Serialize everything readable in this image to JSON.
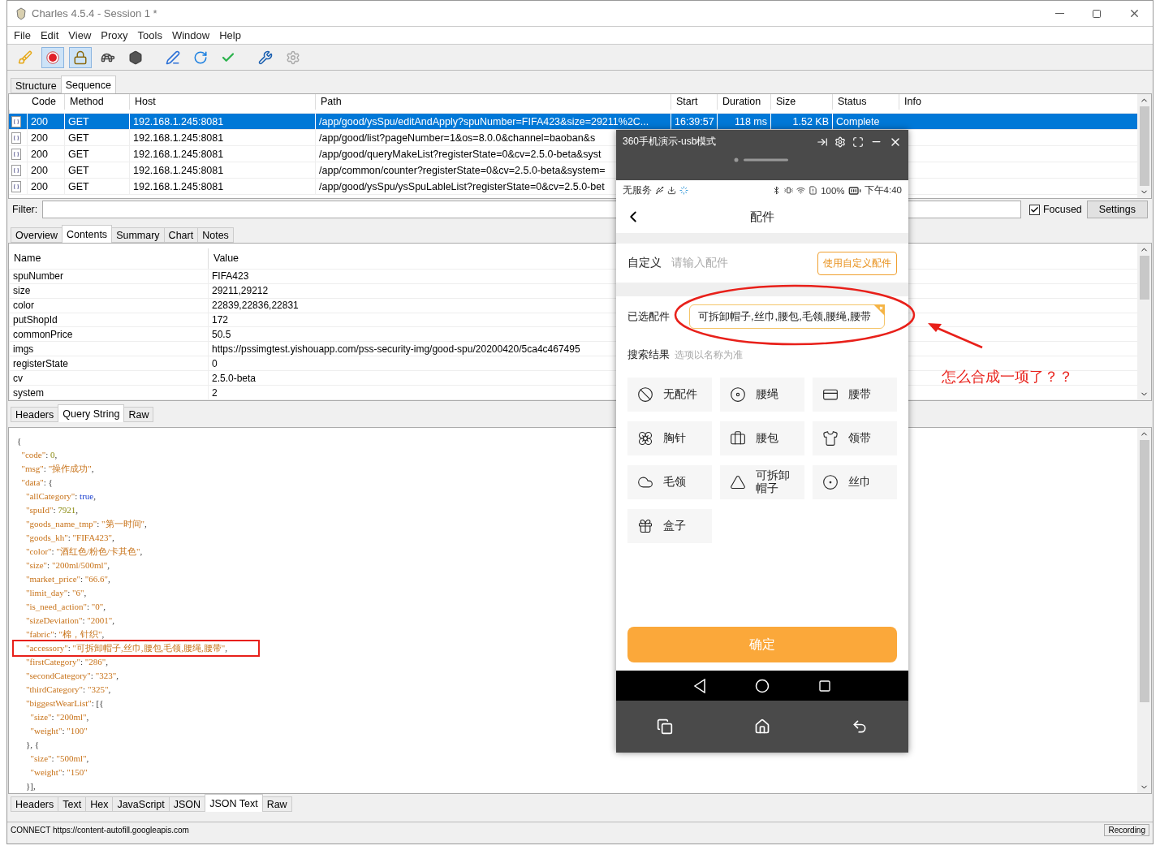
{
  "window": {
    "title": "Charles 4.5.4 - Session 1 *"
  },
  "menu": [
    "File",
    "Edit",
    "View",
    "Proxy",
    "Tools",
    "Window",
    "Help"
  ],
  "toolbar": [
    {
      "pressed": false
    },
    {
      "pressed": true
    },
    {
      "pressed": true
    },
    {
      "pressed": false
    },
    {
      "pressed": false
    },
    {
      "pressed": false
    },
    {
      "pressed": false
    },
    {
      "pressed": false
    },
    {
      "pressed": false
    },
    {
      "pressed": false
    }
  ],
  "view_tabs": [
    {
      "label": "Structure",
      "selected": false
    },
    {
      "label": "Sequence",
      "selected": true
    }
  ],
  "table": {
    "columns": [
      "Code",
      "Method",
      "Host",
      "Path",
      "Start",
      "Duration",
      "Size",
      "Status",
      "Info"
    ],
    "rows": [
      {
        "selected": true,
        "cells": [
          "200",
          "GET",
          "192.168.1.245:8081",
          "/app/good/ysSpu/editAndApply?spuNumber=FIFA423&size=29211%2C...",
          "16:39:57",
          "118 ms",
          "1.52 KB",
          "Complete",
          ""
        ]
      },
      {
        "selected": false,
        "cells": [
          "200",
          "GET",
          "192.168.1.245:8081",
          "/app/good/list?pageNumber=1&os=8.0.0&channel=baoban&s"
        ]
      },
      {
        "selected": false,
        "cells": [
          "200",
          "GET",
          "192.168.1.245:8081",
          "/app/good/queryMakeList?registerState=0&cv=2.5.0-beta&syst"
        ]
      },
      {
        "selected": false,
        "cells": [
          "200",
          "GET",
          "192.168.1.245:8081",
          "/app/common/counter?registerState=0&cv=2.5.0-beta&system="
        ]
      },
      {
        "selected": false,
        "cells": [
          "200",
          "GET",
          "192.168.1.245:8081",
          "/app/good/ysSpu/ysSpuLableList?registerState=0&cv=2.5.0-bet"
        ]
      }
    ]
  },
  "filter": {
    "label": "Filter:",
    "focused": {
      "label": "Focused",
      "checked": true
    },
    "settings": "Settings"
  },
  "detail_tabs": [
    {
      "label": "Overview",
      "selected": false
    },
    {
      "label": "Contents",
      "selected": true
    },
    {
      "label": "Summary",
      "selected": false
    },
    {
      "label": "Chart",
      "selected": false
    },
    {
      "label": "Notes",
      "selected": false
    }
  ],
  "params": {
    "columns": [
      "Name",
      "Value"
    ],
    "rows": [
      [
        "spuNumber",
        "FIFA423"
      ],
      [
        "size",
        "29211,29212"
      ],
      [
        "color",
        "22839,22836,22831"
      ],
      [
        "putShopId",
        "172"
      ],
      [
        "commonPrice",
        "50.5"
      ],
      [
        "imgs",
        "https://pssimgtest.yishouapp.com/pss-security-img/good-spu/20200420/5ca4c467495"
      ],
      [
        "registerState",
        "0"
      ],
      [
        "cv",
        "2.5.0-beta"
      ],
      [
        "system",
        "2"
      ]
    ]
  },
  "request_tabs": [
    {
      "label": "Headers",
      "selected": false
    },
    {
      "label": "Query String",
      "selected": true
    },
    {
      "label": "Raw",
      "selected": false
    }
  ],
  "code_lines": [
    {
      "text": "{",
      "highlighted": false
    },
    {
      "text": "  \"code\": 0,",
      "highlighted": false
    },
    {
      "text": "  \"msg\": \"操作成功\",",
      "highlighted": false
    },
    {
      "text": "  \"data\": {",
      "highlighted": false
    },
    {
      "text": "    \"allCategory\": true,",
      "highlighted": false
    },
    {
      "text": "    \"spuId\": 7921,",
      "highlighted": false
    },
    {
      "text": "    \"goods_name_tmp\": \"第一时间\",",
      "highlighted": false
    },
    {
      "text": "    \"goods_kh\": \"FIFA423\",",
      "highlighted": false
    },
    {
      "text": "    \"color\": \"酒红色/粉色/卡其色\",",
      "highlighted": false
    },
    {
      "text": "    \"size\": \"200ml/500ml\",",
      "highlighted": false
    },
    {
      "text": "    \"market_price\": \"66.6\",",
      "highlighted": false
    },
    {
      "text": "    \"limit_day\": \"6\",",
      "highlighted": false
    },
    {
      "text": "    \"is_need_action\": \"0\",",
      "highlighted": false
    },
    {
      "text": "    \"sizeDeviation\": \"2001\",",
      "highlighted": false
    },
    {
      "text": "    \"fabric\": \"棉，针织\",",
      "highlighted": false
    },
    {
      "text": "    \"accessory\": \"可拆卸帽子,丝巾,腰包,毛领,腰绳,腰带\",",
      "highlighted": true
    },
    {
      "text": "    \"firstCategory\": \"286\",",
      "highlighted": false
    },
    {
      "text": "    \"secondCategory\": \"323\",",
      "highlighted": false
    },
    {
      "text": "    \"thirdCategory\": \"325\",",
      "highlighted": false
    },
    {
      "text": "    \"biggestWearList\": [{",
      "highlighted": false
    },
    {
      "text": "      \"size\": \"200ml\",",
      "highlighted": false
    },
    {
      "text": "      \"weight\": \"100\"",
      "highlighted": false
    },
    {
      "text": "    }, {",
      "highlighted": false
    },
    {
      "text": "      \"size\": \"500ml\",",
      "highlighted": false
    },
    {
      "text": "      \"weight\": \"150\"",
      "highlighted": false
    },
    {
      "text": "    }],",
      "highlighted": false
    }
  ],
  "response_tabs": [
    {
      "label": "Headers",
      "selected": false
    },
    {
      "label": "Text",
      "selected": false
    },
    {
      "label": "Hex",
      "selected": false
    },
    {
      "label": "JavaScript",
      "selected": false
    },
    {
      "label": "JSON",
      "selected": false
    },
    {
      "label": "JSON Text",
      "selected": true
    },
    {
      "label": "Raw",
      "selected": false
    }
  ],
  "status_bar": {
    "message": "CONNECT https://content-autofill.googleapis.com",
    "recording": "Recording"
  },
  "phone": {
    "title": "360手机演示-usb模式",
    "status": {
      "carrier": "无服务",
      "battery": "100%",
      "time": "下午4:40"
    },
    "page_title": "配件",
    "custom": {
      "label": "自定义",
      "placeholder": "请输入配件",
      "button": "使用自定义配件"
    },
    "selected": {
      "label": "已选配件",
      "chips": [
        "可拆卸帽子,丝巾,腰包,毛领,腰绳,腰带"
      ]
    },
    "results": {
      "title": "搜索结果",
      "hint": "选项以名称为准"
    },
    "options": [
      "无配件",
      "腰绳",
      "腰带",
      "胸针",
      "腰包",
      "领带",
      "毛领",
      "可拆卸帽子",
      "丝巾",
      "盒子"
    ],
    "confirm": "确定"
  },
  "annotation": {
    "text": "怎么合成一项了？？"
  }
}
